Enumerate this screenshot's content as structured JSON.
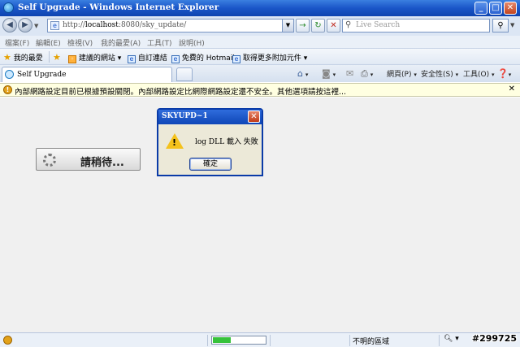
{
  "window": {
    "title": "Self Upgrade - Windows Internet Explorer",
    "min": "_",
    "max": "□",
    "close": "✕"
  },
  "address_bar": {
    "url_prefix": "http://",
    "url_host": "localhost",
    "url_rest": ":8080/sky_update/",
    "back": "◀",
    "forward": "▶",
    "refresh": "↻",
    "stop": "✕",
    "go": "→",
    "search_placeholder": "Live Search",
    "search_icon": "search-icon"
  },
  "menu": [
    "檔案(F)",
    "編輯(E)",
    "檢視(V)",
    "我的最愛(A)",
    "工具(T)",
    "說明(H)"
  ],
  "favorites_bar": {
    "favorites": "我的最愛",
    "suggested": "建議的網站 ▾",
    "custom_links": "自訂連結",
    "hotmail": "免費的 Hotmail",
    "more_addons": "取得更多附加元件 ▾"
  },
  "tab": {
    "label": "Self Upgrade"
  },
  "command_bar": {
    "page": "網頁(P)",
    "safety": "安全性(S)",
    "tools": "工具(O)"
  },
  "info_bar": {
    "message": "內部網路設定目前已根據預設關閉。內部網路設定比網際網路設定還不安全。其他選項請按這裡...",
    "close": "✕"
  },
  "page": {
    "wait_text": "請稍待..."
  },
  "dialog": {
    "title": "SKYUPD~1",
    "message": "log DLL 載入 失敗",
    "ok": "確定",
    "icon": "warning-icon"
  },
  "status_bar": {
    "zone": "不明的區域",
    "zoom_control": "zoom-icon",
    "progress": 0.35
  },
  "watermark": "#299725",
  "colors": {
    "title_blue": "#1a56c8",
    "info_yellow": "#ffffe1",
    "progress_green": "#36c23b",
    "warning_yellow": "#f4c21c"
  }
}
